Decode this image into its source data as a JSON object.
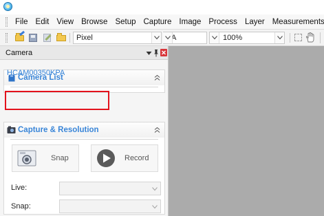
{
  "menu": {
    "items": [
      "File",
      "Edit",
      "View",
      "Browse",
      "Setup",
      "Capture",
      "Image",
      "Process",
      "Layer",
      "Measurements"
    ]
  },
  "toolbar": {
    "icons": [
      "open-icon",
      "save-icon",
      "edit-icon",
      "folder-icon",
      "rectangle-select-icon",
      "hand-icon"
    ],
    "unit_combo": {
      "value": "Pixel"
    },
    "na_combo": {
      "value": "NA"
    },
    "zoom_combo": {
      "value": "100%"
    }
  },
  "camera_panel": {
    "title": "Camera",
    "header_icons": [
      "dropdown-icon",
      "pin-icon",
      "close-icon"
    ],
    "camera_list": {
      "title": "Camera List",
      "items": [
        "HCAM00350KPA"
      ]
    },
    "capture": {
      "title": "Capture & Resolution",
      "snap_label": "Snap",
      "record_label": "Record",
      "live_label": "Live:",
      "snap_field_label": "Snap:",
      "live_value": "",
      "snap_value": ""
    }
  },
  "colors": {
    "accent_blue": "#3a86d8",
    "highlight_red": "#e3121c",
    "workspace_gray": "#ababab",
    "close_red": "#d8363b"
  }
}
